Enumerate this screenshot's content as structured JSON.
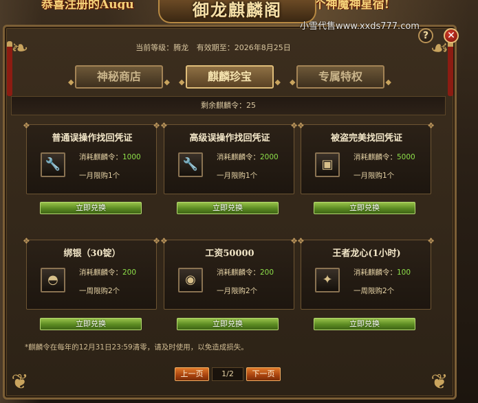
{
  "banner": {
    "left_text": "恭喜注册的Augu",
    "right_text": "个神魔神星宿!",
    "title": "御龙麒麟阁"
  },
  "watermark": "小雪代售www.xxds777.com",
  "window": {
    "help_label": "?",
    "close_label": "✕"
  },
  "info": {
    "level_label": "当前等级：",
    "level_value": "腾龙",
    "expiry_label": "有效期至：",
    "expiry_value": "2026年8月25日"
  },
  "tabs": [
    {
      "label": "神秘商店",
      "active": false
    },
    {
      "label": "麒麟珍宝",
      "active": true
    },
    {
      "label": "专属特权",
      "active": false
    }
  ],
  "remaining": {
    "label": "剩余麒麟令：",
    "value": "25"
  },
  "cards": [
    {
      "title": "普通误操作找回凭证",
      "icon": "wrench-icon",
      "icon_glyph": "🔧",
      "cost_label": "消耗麒麟令：",
      "cost": "1000",
      "limit": "一月限购1个",
      "button": "立即兑换"
    },
    {
      "title": "高级误操作找回凭证",
      "icon": "wrench-icon",
      "icon_glyph": "🔧",
      "cost_label": "消耗麒麟令：",
      "cost": "2000",
      "limit": "一月限购1个",
      "button": "立即兑换"
    },
    {
      "title": "被盗完美找回凭证",
      "icon": "chest-icon",
      "icon_glyph": "▣",
      "cost_label": "消耗麒麟令：",
      "cost": "5000",
      "limit": "一月限购1个",
      "button": "立即兑换"
    },
    {
      "title": "绑银（30锭）",
      "icon": "silver-ingot-icon",
      "icon_glyph": "◓",
      "cost_label": "消耗麒麟令：",
      "cost": "200",
      "limit": "一周限购2个",
      "button": "立即兑换"
    },
    {
      "title": "工资50000",
      "icon": "gold-ingot-icon",
      "icon_glyph": "◉",
      "cost_label": "消耗麒麟令：",
      "cost": "200",
      "limit": "一月限购2个",
      "button": "立即兑换"
    },
    {
      "title": "王者龙心(1小时)",
      "icon": "dragon-heart-icon",
      "icon_glyph": "✦",
      "cost_label": "消耗麒麟令：",
      "cost": "100",
      "limit": "一周限购2个",
      "button": "立即兑换"
    }
  ],
  "note": "*麒麟令在每年的12月31日23:59清零，请及时使用，以免造成损失。",
  "pagination": {
    "prev": "上一页",
    "current": "1/2",
    "next": "下一页"
  },
  "colors": {
    "accent": "#f6e4b0",
    "cost_value": "#8ee04a",
    "redeem_button": "#5b8a22",
    "page_button": "#a8420e"
  }
}
